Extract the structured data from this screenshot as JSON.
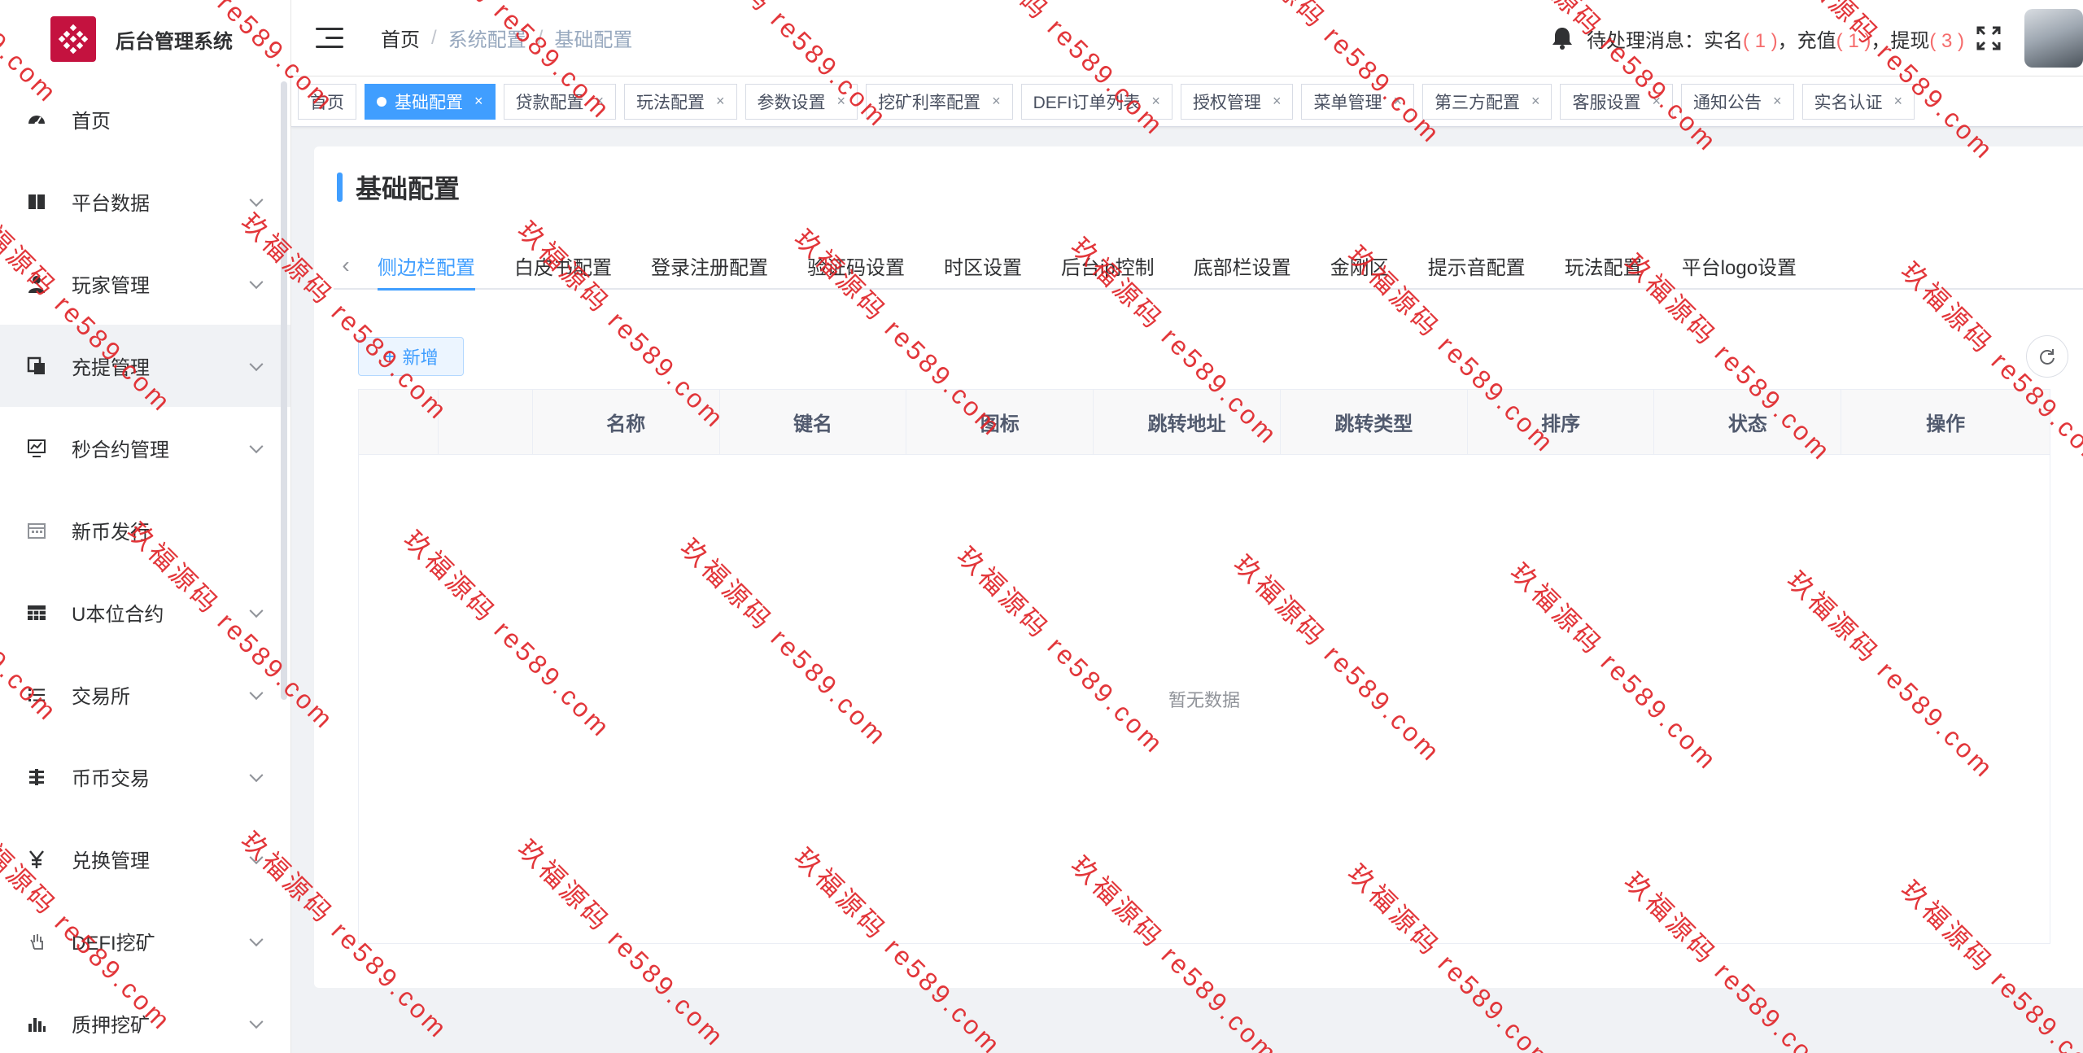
{
  "app": {
    "title": "后台管理系统",
    "brand_color": "#c4123f",
    "accent_color": "#409eff"
  },
  "sidebar": {
    "items": [
      {
        "label": "首页",
        "icon": "dashboard-icon",
        "has_submenu": false,
        "active": false
      },
      {
        "label": "平台数据",
        "icon": "book-icon",
        "has_submenu": true,
        "active": false
      },
      {
        "label": "玩家管理",
        "icon": "user-icon",
        "has_submenu": true,
        "active": false
      },
      {
        "label": "充提管理",
        "icon": "copy-icon",
        "has_submenu": true,
        "active": true
      },
      {
        "label": "秒合约管理",
        "icon": "monitor-chart-icon",
        "has_submenu": true,
        "active": false
      },
      {
        "label": "新币发行",
        "icon": "calendar-icon",
        "has_submenu": false,
        "active": false
      },
      {
        "label": "U本位合约",
        "icon": "table-icon",
        "has_submenu": true,
        "active": false
      },
      {
        "label": "交易所",
        "icon": "list-icon",
        "has_submenu": true,
        "active": false
      },
      {
        "label": "币币交易",
        "icon": "swap-icon",
        "has_submenu": true,
        "active": false
      },
      {
        "label": "兑换管理",
        "icon": "yen-icon",
        "has_submenu": true,
        "active": false
      },
      {
        "label": "DEFI挖矿",
        "icon": "hand-icon",
        "has_submenu": true,
        "active": false
      },
      {
        "label": "质押挖矿",
        "icon": "bar-chart-icon",
        "has_submenu": true,
        "active": false
      }
    ]
  },
  "header": {
    "breadcrumb": [
      "首页",
      "系统配置",
      "基础配置"
    ],
    "notice": {
      "prefix": "待处理消息：实名",
      "realname_count": "( 1 )",
      "recharge_label": "，充值",
      "recharge_count": "( 1 )",
      "withdraw_label": "，提现",
      "withdraw_count": "( 3 )"
    }
  },
  "tags": [
    {
      "label": "首页",
      "active": false,
      "closable": false
    },
    {
      "label": "基础配置",
      "active": true,
      "closable": true
    },
    {
      "label": "贷款配置",
      "active": false,
      "closable": true
    },
    {
      "label": "玩法配置",
      "active": false,
      "closable": true
    },
    {
      "label": "参数设置",
      "active": false,
      "closable": true
    },
    {
      "label": "挖矿利率配置",
      "active": false,
      "closable": true
    },
    {
      "label": "DEFI订单列表",
      "active": false,
      "closable": true
    },
    {
      "label": "授权管理",
      "active": false,
      "closable": true
    },
    {
      "label": "菜单管理",
      "active": false,
      "closable": true
    },
    {
      "label": "第三方配置",
      "active": false,
      "closable": true
    },
    {
      "label": "客服设置",
      "active": false,
      "closable": true
    },
    {
      "label": "通知公告",
      "active": false,
      "closable": true
    },
    {
      "label": "实名认证",
      "active": false,
      "closable": true
    }
  ],
  "tag_close_glyph": "×",
  "main": {
    "title": "基础配置",
    "sub_tabs": [
      "侧边栏配置",
      "白皮书配置",
      "登录注册配置",
      "验证码设置",
      "时区设置",
      "后台ip控制",
      "底部栏设置",
      "金刚区",
      "提示音配置",
      "玩法配置",
      "平台logo设置"
    ],
    "active_sub_tab": 0,
    "add_button": "新增",
    "table": {
      "columns": [
        "",
        "",
        "名称",
        "键名",
        "图标",
        "跳转地址",
        "跳转类型",
        "排序",
        "状态",
        "操作"
      ],
      "empty_text": "暂无数据"
    }
  },
  "watermark": {
    "text_cn": "玖福源码",
    "text_url": "re589.com",
    "color": "#e0262a"
  }
}
